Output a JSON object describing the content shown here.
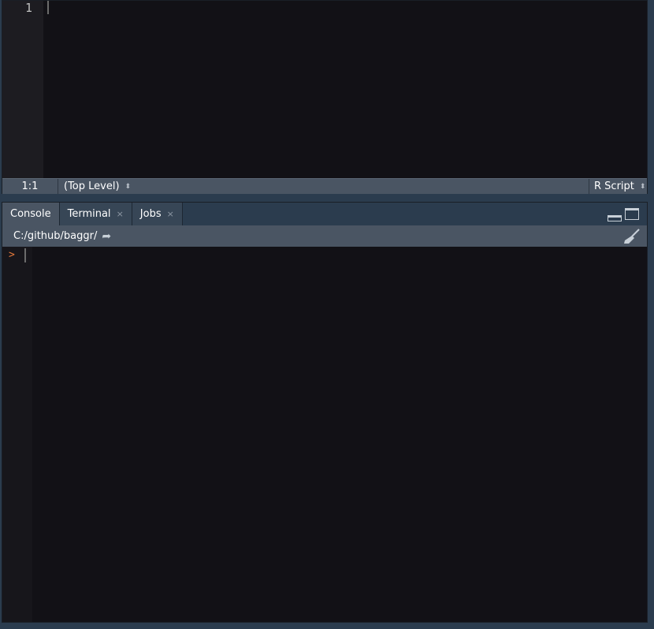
{
  "editor": {
    "line_numbers": [
      "1"
    ],
    "status": {
      "position": "1:1",
      "scope": "(Top Level)",
      "file_type": "R Script"
    }
  },
  "console": {
    "tabs": [
      {
        "label": "Console",
        "active": true,
        "closable": false
      },
      {
        "label": "Terminal",
        "active": false,
        "closable": true
      },
      {
        "label": "Jobs",
        "active": false,
        "closable": true
      }
    ],
    "close_glyph": "×",
    "working_directory": "C:/github/baggr/",
    "prompt": ">"
  },
  "icons": {
    "go_to_directory": "arrow-right-icon",
    "clear_console": "broom-icon",
    "minimize": "minimize-pane-icon",
    "maximize": "maximize-pane-icon"
  },
  "colors": {
    "background": "#121116",
    "chrome": "#2b3c4e",
    "bar": "#4a5563",
    "prompt": "#e5793b"
  }
}
